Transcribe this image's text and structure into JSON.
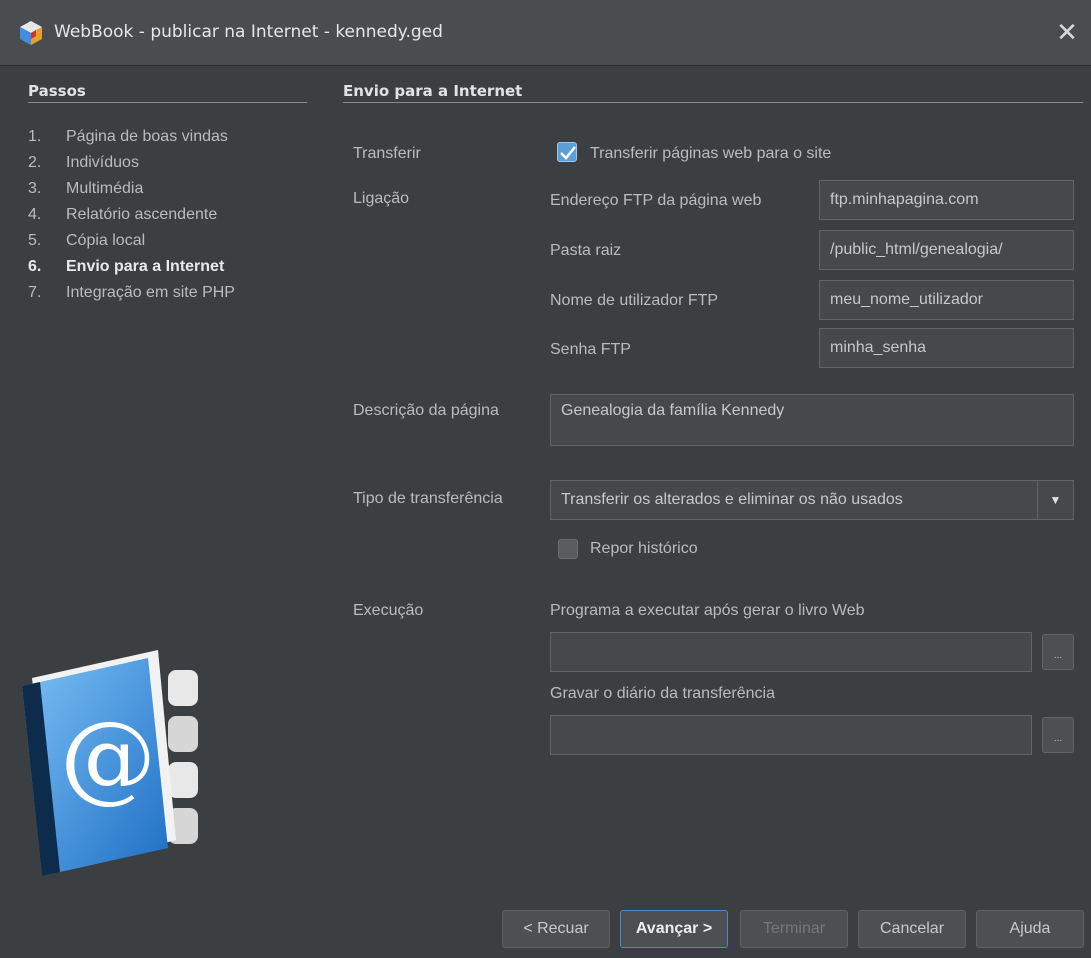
{
  "window": {
    "title": "WebBook - publicar na Internet - kennedy.ged",
    "close_glyph": "✕"
  },
  "steps": {
    "header": "Passos",
    "items": [
      {
        "num": "1.",
        "label": "Página de boas vindas"
      },
      {
        "num": "2.",
        "label": "Indivíduos"
      },
      {
        "num": "3.",
        "label": "Multimédia"
      },
      {
        "num": "4.",
        "label": "Relatório ascendente"
      },
      {
        "num": "5.",
        "label": "Cópia local"
      },
      {
        "num": "6.",
        "label": "Envio para a Internet"
      },
      {
        "num": "7.",
        "label": "Integração em site PHP"
      }
    ],
    "active_index": 5
  },
  "main": {
    "header": "Envio para a Internet",
    "transfer": {
      "label": "Transferir",
      "checkbox_label": "Transferir páginas web para o site",
      "checked": true
    },
    "connection": {
      "label": "Ligação",
      "ftp_address_label": "Endereço FTP da página web",
      "ftp_address": "ftp.minhapagina.com",
      "root_folder_label": "Pasta raiz",
      "root_folder": "/public_html/genealogia/",
      "ftp_user_label": "Nome de utilizador FTP",
      "ftp_user": "meu_nome_utilizador",
      "ftp_password_label": "Senha FTP",
      "ftp_password": "minha_senha"
    },
    "description": {
      "label": "Descrição da página",
      "value": "Genealogia da família Kennedy"
    },
    "transfer_type": {
      "label": "Tipo de transferência",
      "selected": "Transferir os alterados e eliminar os não usados",
      "reset_history_label": "Repor histórico",
      "reset_history_checked": false
    },
    "execution": {
      "label": "Execução",
      "program_label": "Programa a executar após gerar o livro Web",
      "program_value": "",
      "log_label": "Gravar o diário da transferência",
      "log_value": "",
      "browse_glyph": "..."
    }
  },
  "buttons": {
    "back": "< Recuar",
    "next": "Avançar >",
    "finish": "Terminar",
    "cancel": "Cancelar",
    "help": "Ajuda"
  },
  "colors": {
    "background": "#3c3f41",
    "accent": "#4a89c9",
    "checkbox": "#5b9fd8"
  },
  "icons": [
    "webbook-app-icon",
    "close-icon",
    "address-book-icon",
    "checkmark-icon",
    "dropdown-arrow-icon"
  ]
}
